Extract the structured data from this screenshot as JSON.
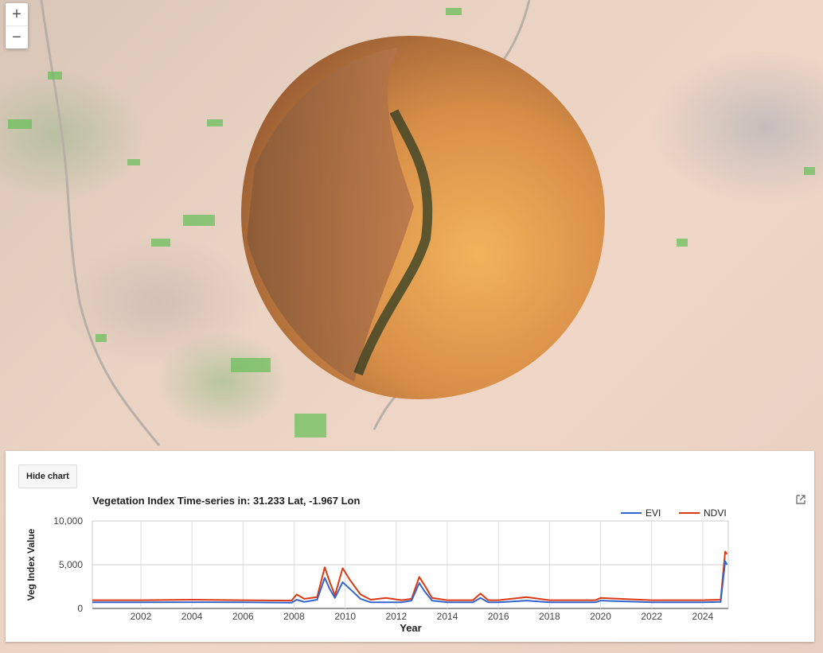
{
  "map": {
    "zoom_in_label": "+",
    "zoom_out_label": "−"
  },
  "panel": {
    "hide_button_label": "Hide chart",
    "popout_icon": "open-in-new-icon"
  },
  "chart_data": {
    "type": "line",
    "title": "Vegetation Index Time-series in: 31.233 Lat, -1.967 Lon",
    "xlabel": "Year",
    "ylabel": "Veg Index Value",
    "xlim": [
      2000.1,
      2025.0
    ],
    "ylim": [
      0,
      10000
    ],
    "y_ticks": [
      0,
      5000,
      10000
    ],
    "y_tick_labels": [
      "0",
      "5,000",
      "10,000"
    ],
    "x_ticks": [
      2002,
      2004,
      2006,
      2008,
      2010,
      2012,
      2014,
      2016,
      2018,
      2020,
      2022,
      2024
    ],
    "x_tick_labels": [
      "2002",
      "2004",
      "2006",
      "2008",
      "2010",
      "2012",
      "2014",
      "2016",
      "2018",
      "2020",
      "2022",
      "2024"
    ],
    "grid": true,
    "legend_position": "top-right",
    "series": [
      {
        "name": "EVI",
        "color": "#3366cc",
        "x": [
          2000.1,
          2002,
          2004,
          2006,
          2007.9,
          2008.1,
          2008.4,
          2008.9,
          2009.2,
          2009.4,
          2009.6,
          2009.9,
          2010.2,
          2010.6,
          2011,
          2012.2,
          2012.6,
          2012.9,
          2013.1,
          2013.4,
          2014,
          2015,
          2015.3,
          2015.6,
          2016,
          2017.1,
          2018,
          2019.8,
          2020,
          2022,
          2024,
          2024.7,
          2024.88,
          2024.95
        ],
        "y": [
          700,
          700,
          720,
          700,
          650,
          1000,
          750,
          1000,
          3500,
          2200,
          1200,
          3000,
          2200,
          1100,
          700,
          700,
          900,
          2900,
          2000,
          900,
          700,
          700,
          1200,
          700,
          700,
          900,
          700,
          700,
          900,
          700,
          700,
          750,
          5400,
          5000
        ]
      },
      {
        "name": "NDVI",
        "color": "#dc3912",
        "x": [
          2000.1,
          2002,
          2004,
          2006,
          2007.9,
          2008.1,
          2008.4,
          2008.9,
          2009.2,
          2009.4,
          2009.6,
          2009.9,
          2010.2,
          2010.6,
          2011,
          2011.6,
          2012.2,
          2012.6,
          2012.9,
          2013.1,
          2013.4,
          2014,
          2015,
          2015.3,
          2015.6,
          2016,
          2017.1,
          2018,
          2019.8,
          2020,
          2022,
          2024,
          2024.7,
          2024.88,
          2024.95
        ],
        "y": [
          950,
          950,
          1000,
          950,
          900,
          1600,
          1100,
          1300,
          4700,
          3000,
          1500,
          4600,
          3200,
          1600,
          1000,
          1200,
          950,
          1100,
          3600,
          2700,
          1200,
          950,
          950,
          1700,
          950,
          950,
          1300,
          950,
          950,
          1200,
          950,
          950,
          1000,
          6500,
          6200
        ]
      }
    ]
  }
}
